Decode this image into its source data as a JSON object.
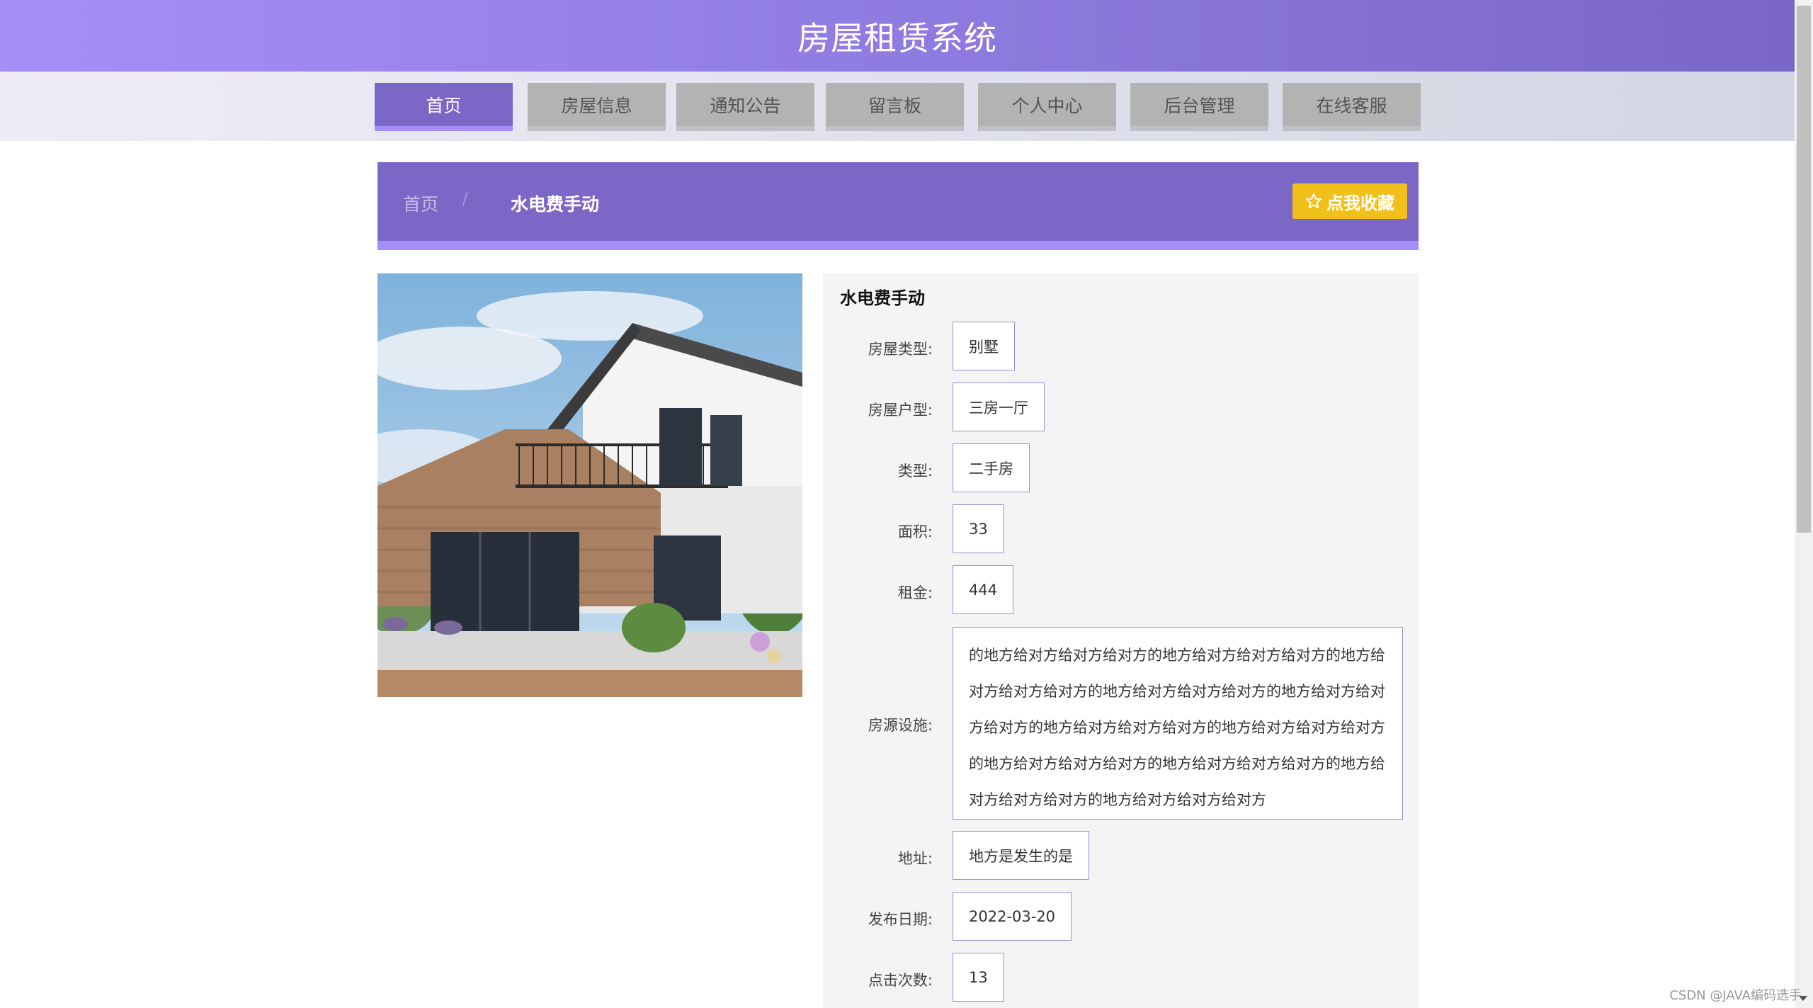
{
  "header": {
    "title": "房屋租赁系统"
  },
  "nav": {
    "items": [
      {
        "label": "首页",
        "active": true
      },
      {
        "label": "房屋信息",
        "active": false
      },
      {
        "label": "通知公告",
        "active": false
      },
      {
        "label": "留言板",
        "active": false
      },
      {
        "label": "个人中心",
        "active": false
      },
      {
        "label": "后台管理",
        "active": false
      },
      {
        "label": "在线客服",
        "active": false
      }
    ]
  },
  "breadcrumb": {
    "home": "首页",
    "separator": "/",
    "current": "水电费手动"
  },
  "favorite_button": {
    "label": "点我收藏",
    "icon": "star-outline-icon"
  },
  "detail": {
    "title": "水电费手动",
    "fields": [
      {
        "label": "房屋类型:",
        "value": "别墅"
      },
      {
        "label": "房屋户型:",
        "value": "三房一厅"
      },
      {
        "label": "类型:",
        "value": "二手房"
      },
      {
        "label": "面积:",
        "value": "33"
      },
      {
        "label": "租金:",
        "value": "444"
      },
      {
        "label": "房源设施:",
        "value": "的地方给对方给对方给对方的地方给对方给对方给对方的地方给对方给对方给对方的地方给对方给对方给对方的地方给对方给对方给对方的地方给对方给对方给对方的地方给对方给对方给对方的地方给对方给对方给对方的地方给对方给对方给对方的地方给对方给对方给对方的地方给对方给对方给对方"
      },
      {
        "label": "地址:",
        "value": "地方是发生的是"
      },
      {
        "label": "发布日期:",
        "value": "2022-03-20"
      },
      {
        "label": "点击次数:",
        "value": "13"
      }
    ]
  },
  "watermark": "CSDN @JAVA编码选手",
  "colors": {
    "primary": "#7b67c6",
    "accent": "#a68ef8",
    "favorite": "#f2c01b",
    "nav_inactive": "#b3b3b3"
  }
}
